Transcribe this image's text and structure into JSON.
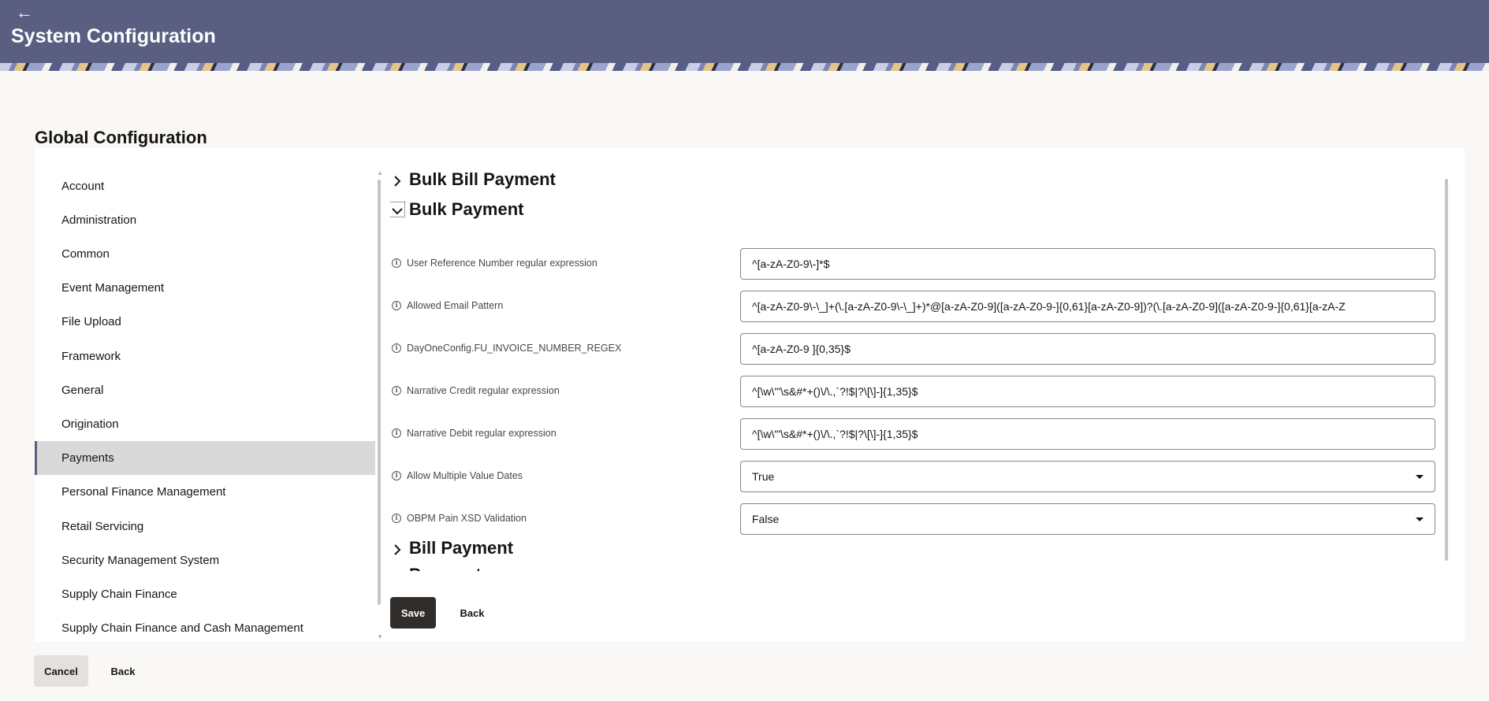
{
  "header": {
    "title": "System Configuration",
    "back_icon": "arrow-left-icon",
    "color": "#5a5f82"
  },
  "page": {
    "section_title": "Global Configuration"
  },
  "sidebar": {
    "items": [
      {
        "label": "Account"
      },
      {
        "label": "Administration"
      },
      {
        "label": "Common"
      },
      {
        "label": "Event Management"
      },
      {
        "label": "File Upload"
      },
      {
        "label": "Framework"
      },
      {
        "label": "General"
      },
      {
        "label": "Origination"
      },
      {
        "label": "Payments",
        "active": true
      },
      {
        "label": "Personal Finance Management"
      },
      {
        "label": "Retail Servicing"
      },
      {
        "label": "Security Management System"
      },
      {
        "label": "Supply Chain Finance"
      },
      {
        "label": "Supply Chain Finance and Cash Management"
      }
    ]
  },
  "content": {
    "groups": [
      {
        "label": "Bulk Bill Payment",
        "expanded": false
      },
      {
        "label": "Bulk Payment",
        "expanded": true
      },
      {
        "label": "Bill Payment",
        "expanded": false
      },
      {
        "label": "Payment",
        "expanded": false
      }
    ],
    "fields": [
      {
        "label": "User Reference Number regular expression",
        "value": "^[a-zA-Z0-9\\-]*$",
        "type": "text"
      },
      {
        "label": "Allowed Email Pattern",
        "value": "^[a-zA-Z0-9\\-\\_]+(\\.[a-zA-Z0-9\\-\\_]+)*@[a-zA-Z0-9]([a-zA-Z0-9-]{0,61}[a-zA-Z0-9])?(\\.[a-zA-Z0-9]([a-zA-Z0-9-]{0,61}[a-zA-Z",
        "type": "text"
      },
      {
        "label": "DayOneConfig.FU_INVOICE_NUMBER_REGEX",
        "value": "^[a-zA-Z0-9 ]{0,35}$",
        "type": "text"
      },
      {
        "label": "Narrative Credit regular expression",
        "value": "^[\\w\\'\"\\s&#*+()\\/\\.,`?!$|?\\[\\]-]{1,35}$",
        "type": "text"
      },
      {
        "label": "Narrative Debit regular expression",
        "value": "^[\\w\\'\"\\s&#*+()\\/\\.,`?!$|?\\[\\]-]{1,35}$",
        "type": "text"
      },
      {
        "label": "Allow Multiple Value Dates",
        "value": "True",
        "type": "select"
      },
      {
        "label": "OBPM Pain XSD Validation",
        "value": "False",
        "type": "select"
      }
    ],
    "save_label": "Save",
    "back_label": "Back"
  },
  "footer": {
    "cancel_label": "Cancel",
    "back_label": "Back"
  }
}
